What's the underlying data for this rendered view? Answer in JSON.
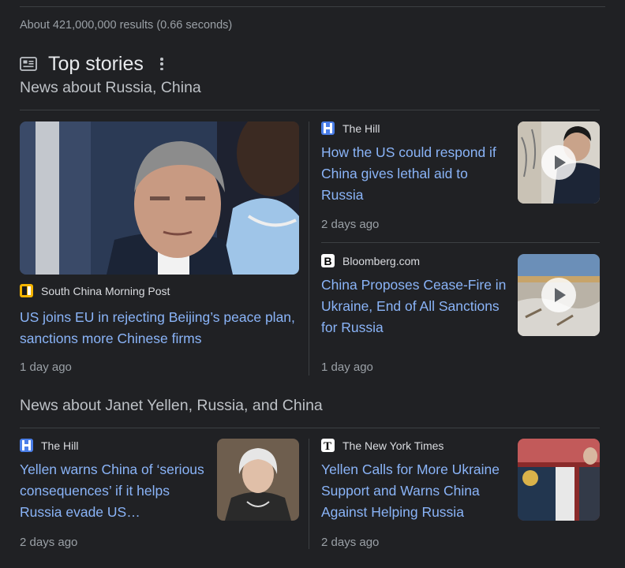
{
  "result_stats": "About 421,000,000 results (0.66 seconds)",
  "top_stories": {
    "title": "Top stories",
    "icons": {
      "section": "newspaper-icon",
      "menu": "more-vert-icon"
    }
  },
  "sections": [
    {
      "label": "News about Russia, China",
      "stories": [
        {
          "source": "South China Morning Post",
          "headline": "US joins EU in rejecting Beijing’s peace plan, sanctions more Chinese firms",
          "age": "1 day ago",
          "favicon_colors": [
            "#f4b400",
            "#1a1a1a"
          ]
        },
        {
          "source": "The Hill",
          "headline": "How the US could respond if China gives lethal aid to Russia",
          "age": "2 days ago",
          "video": true,
          "favicon_colors": [
            "#4a7ee8",
            "#ffffff"
          ]
        },
        {
          "source": "Bloomberg.com",
          "headline": "China Proposes Cease-Fire in Ukraine, End of All Sanctions for Russia",
          "age": "1 day ago",
          "video": true,
          "favicon_colors": [
            "#ffffff",
            "#000000"
          ]
        }
      ]
    },
    {
      "label": "News about Janet Yellen, Russia, and China",
      "stories": [
        {
          "source": "The Hill",
          "headline": "Yellen warns China of ‘serious consequences’ if it helps Russia evade US…",
          "age": "2 days ago",
          "favicon_colors": [
            "#4a7ee8",
            "#ffffff"
          ]
        },
        {
          "source": "The New York Times",
          "headline": "Yellen Calls for More Ukraine Support and Warns China Against Helping Russia",
          "age": "2 days ago",
          "favicon_colors": [
            "#ffffff",
            "#000000"
          ]
        }
      ]
    }
  ],
  "colors": {
    "background": "#202124",
    "link": "#8ab4f8",
    "text": "#bdc1c6",
    "muted": "#9aa0a6",
    "divider": "#3c4043"
  }
}
